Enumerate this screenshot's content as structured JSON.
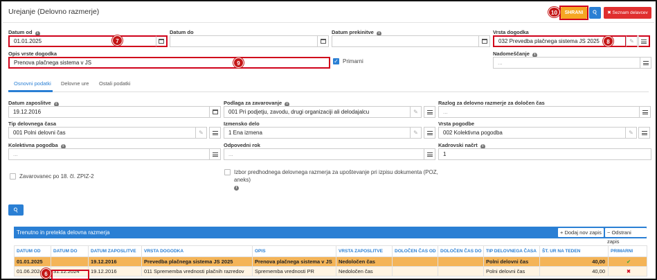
{
  "header": {
    "title": "Urejanje (Delovno razmerje)",
    "save_label": "SHRANI",
    "seznam_label": "✖ Seznam delavcev",
    "save_marker": "10"
  },
  "form": {
    "datum_od": {
      "label": "Datum od",
      "value": "01.01.2025",
      "marker": "7"
    },
    "datum_do": {
      "label": "Datum do",
      "value": ""
    },
    "datum_prekinitve": {
      "label": "Datum prekinitve",
      "value": ""
    },
    "vrsta_dogodka": {
      "label": "Vrsta dogodka",
      "value": "032 Prevedba plačnega sistema JS 2025",
      "marker": "8"
    },
    "opis_vrste_dogodka": {
      "label": "Opis vrste dogodka",
      "value": "Prenova plačnega sistema v JS",
      "marker": "9"
    },
    "primarni_label": "Primarni",
    "nadomescanje": {
      "label": "Nadomeščanje",
      "placeholder": "..."
    }
  },
  "tabs": [
    "Osnovni podatki",
    "Delovne ure",
    "Ostali podatki"
  ],
  "osnovni": {
    "datum_zaposlitve": {
      "label": "Datum zaposlitve",
      "value": "19.12.2016"
    },
    "podlaga": {
      "label": "Podlaga za zavarovanje",
      "value": "001 Pri podjetju, zavodu, drugi organizaciji ali delodajalcu"
    },
    "razlog": {
      "label": "Razlog za delovno razmerje za določen čas",
      "placeholder": "..."
    },
    "tip_delovnega_casa": {
      "label": "Tip delovnega časa",
      "value": "001 Polni delovni čas"
    },
    "izmensko_delo": {
      "label": "Izmensko delo",
      "value": "1 Ena izmena"
    },
    "vrsta_pogodbe": {
      "label": "Vrsta pogodbe",
      "value": "002 Kolektivna pogodba"
    },
    "kolektivna_pogodba": {
      "label": "Kolektivna pogodba",
      "placeholder": "..."
    },
    "odpovedni_rok": {
      "label": "Odpovedni rok",
      "placeholder": "..."
    },
    "kadrovski_nacrt": {
      "label": "Kadrovski načrt",
      "value": "1"
    },
    "zavarovanec_label": "Zavarovanec po 18. čl. ZPIZ-2",
    "izbor_label_1": "Izbor predhodnega delovnega razmerja za upoštevanje pri izpisu dokumenta (POZ,",
    "izbor_label_2": "aneks)"
  },
  "grid": {
    "title": "Trenutno in pretekla delovna razmerja",
    "add_label": "+ Dodaj nov zapis",
    "remove_label": "− Odstrani zapis",
    "row_marker": "6",
    "columns": [
      "DATUM OD",
      "DATUM DO",
      "DATUM ZAPOSLITVE",
      "VRSTA DOGODKA",
      "OPIS",
      "VRSTA ZAPOSLITVE",
      "DOLOČEN ČAS OD",
      "DOLOČEN ČAS DO",
      "TIP DELOVNEGA ČASA",
      "ŠT. UR NA TEDEN",
      "PRIMARNI"
    ],
    "rows": [
      [
        "01.01.2025",
        "",
        "19.12.2016",
        "Prevedba plačnega sistema JS 2025",
        "Prenova plačnega sistema v JS",
        "Nedoločen čas",
        "",
        "",
        "Polni delovni čas",
        "40,00",
        "✔"
      ],
      [
        "01.06.2024",
        "31.12.2024",
        "19.12.2016",
        "011 Sprememba vrednosti plačnih razredov",
        "Sprememba vrednosti PR",
        "Nedoločen čas",
        "",
        "",
        "Polni delovni čas",
        "40,00",
        "✖"
      ]
    ]
  },
  "colors": {
    "accent": "#2a7fd4",
    "save": "#f5a623",
    "danger": "#e02f2f",
    "highlight": "#d0021b",
    "row_active": "#f4b457"
  }
}
